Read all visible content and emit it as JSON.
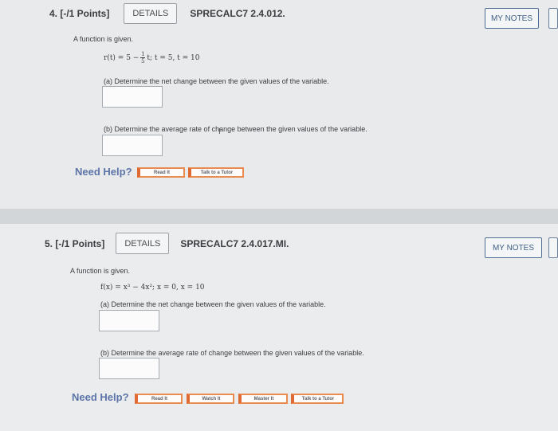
{
  "questions": [
    {
      "number_points": "4. [-/1 Points]",
      "details_label": "DETAILS",
      "code": "SPRECALC7 2.4.012.",
      "mynotes_label": "MY NOTES",
      "intro": "A function is given.",
      "formula": {
        "lhs": "r(t) = 5 −",
        "frac_num": "1",
        "frac_den": "5",
        "rhs": "t;   t = 5, t = 10"
      },
      "part_a": "(a) Determine the net change between the given values of the variable.",
      "part_b": "(b) Determine the average rate of change between the given values of the variable.",
      "need_help": "Need Help?",
      "help_buttons": [
        "Read It",
        "Talk to a Tutor"
      ]
    },
    {
      "number_points": "5. [-/1 Points]",
      "details_label": "DETAILS",
      "code": "SPRECALC7 2.4.017.MI.",
      "mynotes_label": "MY NOTES",
      "intro": "A function is given.",
      "formula": {
        "full": "f(x) = x³ − 4x²;    x = 0, x = 10"
      },
      "part_a": "(a) Determine the net change between the given values of the variable.",
      "part_b": "(b) Determine the average rate of change between the given values of the variable.",
      "need_help": "Need Help?",
      "help_buttons": [
        "Read It",
        "Watch It",
        "Master It",
        "Talk to a Tutor"
      ]
    }
  ]
}
